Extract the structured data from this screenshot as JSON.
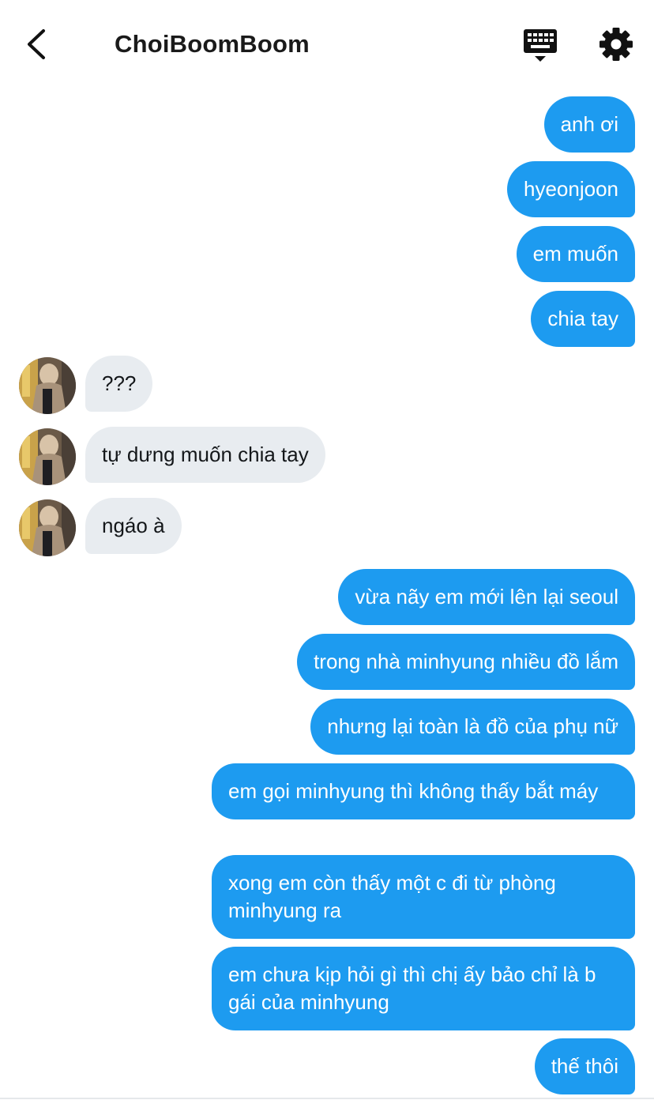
{
  "header": {
    "title": "ChoiBoomBoom",
    "back_icon": "back-arrow-icon",
    "keyboard_icon": "keyboard-icon",
    "settings_icon": "gear-icon"
  },
  "colors": {
    "outgoing_bubble": "#1d9bf0",
    "incoming_bubble": "#e8ecf0",
    "title_text": "#1a1a1a"
  },
  "messages": [
    {
      "direction": "out",
      "text": "anh ơi"
    },
    {
      "direction": "out",
      "text": "hyeonjoon"
    },
    {
      "direction": "out",
      "text": "em muốn"
    },
    {
      "direction": "out",
      "text": "chia tay"
    },
    {
      "direction": "in",
      "text": "???"
    },
    {
      "direction": "in",
      "text": "tự dưng muốn chia tay"
    },
    {
      "direction": "in",
      "text": "ngáo à"
    },
    {
      "direction": "out",
      "text": "vừa nãy em mới lên lại seoul"
    },
    {
      "direction": "out",
      "text": "trong nhà minhyung nhiều đồ lắm"
    },
    {
      "direction": "out",
      "text": "nhưng lại toàn là đồ của phụ nữ"
    },
    {
      "direction": "out",
      "text": "em gọi minhyung thì không thấy bắt máy"
    },
    {
      "direction": "out",
      "text": "xong em còn thấy một c đi từ phòng minhyung ra"
    },
    {
      "direction": "out",
      "text": "em chưa kịp hỏi gì thì chị ấy bảo chỉ là b gái của minhyung"
    },
    {
      "direction": "out",
      "text": "thế thôi"
    }
  ]
}
